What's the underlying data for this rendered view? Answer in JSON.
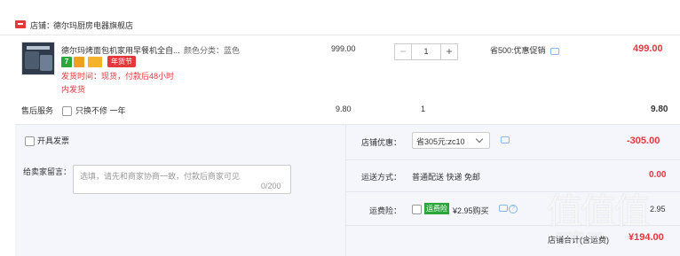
{
  "store": {
    "label": "店铺：",
    "name": "德尔玛厨房电器旗舰店"
  },
  "item": {
    "title": "德尔玛烤面包机家用早餐机全自...",
    "spec": "颜色分类：蓝色",
    "tag": "年货节",
    "ship_time": "发货时间：现货，付款后48小时",
    "ship_note": "内发货",
    "unit_price": "999.00",
    "quantity": "1",
    "promo": "省500:优惠促销",
    "total": "499.00"
  },
  "service": {
    "label": "售后服务",
    "option": "只换不修 一年",
    "price": "9.80",
    "qty": "1",
    "total": "9.80"
  },
  "order": {
    "invoice_label": "开具发票",
    "message_label": "给卖家留言：",
    "message_placeholder": "选填，请先和商家协商一致，付款后商家可见",
    "message_count": "0/200",
    "coupon_label": "店铺优惠：",
    "coupon_value": "省305元:zc10",
    "coupon_amount": "-305.00",
    "shipping_label": "运送方式：",
    "shipping_mode": "普通配送 快递 免邮",
    "shipping_amount": "0.00",
    "insurance_label": "运费险：",
    "insurance_badge": "运费险",
    "insurance_text": "¥2.95购买",
    "insurance_amount": "2.95",
    "total_label": "店铺合计(含运费)",
    "total_amount": "¥194.00"
  },
  "watermark": {
    "text": "值值值",
    "url": "smzdm.com"
  },
  "colors": {
    "accent": "#e4393c",
    "badge_green": "#2aa63a",
    "panel": "#f4f6fb"
  }
}
